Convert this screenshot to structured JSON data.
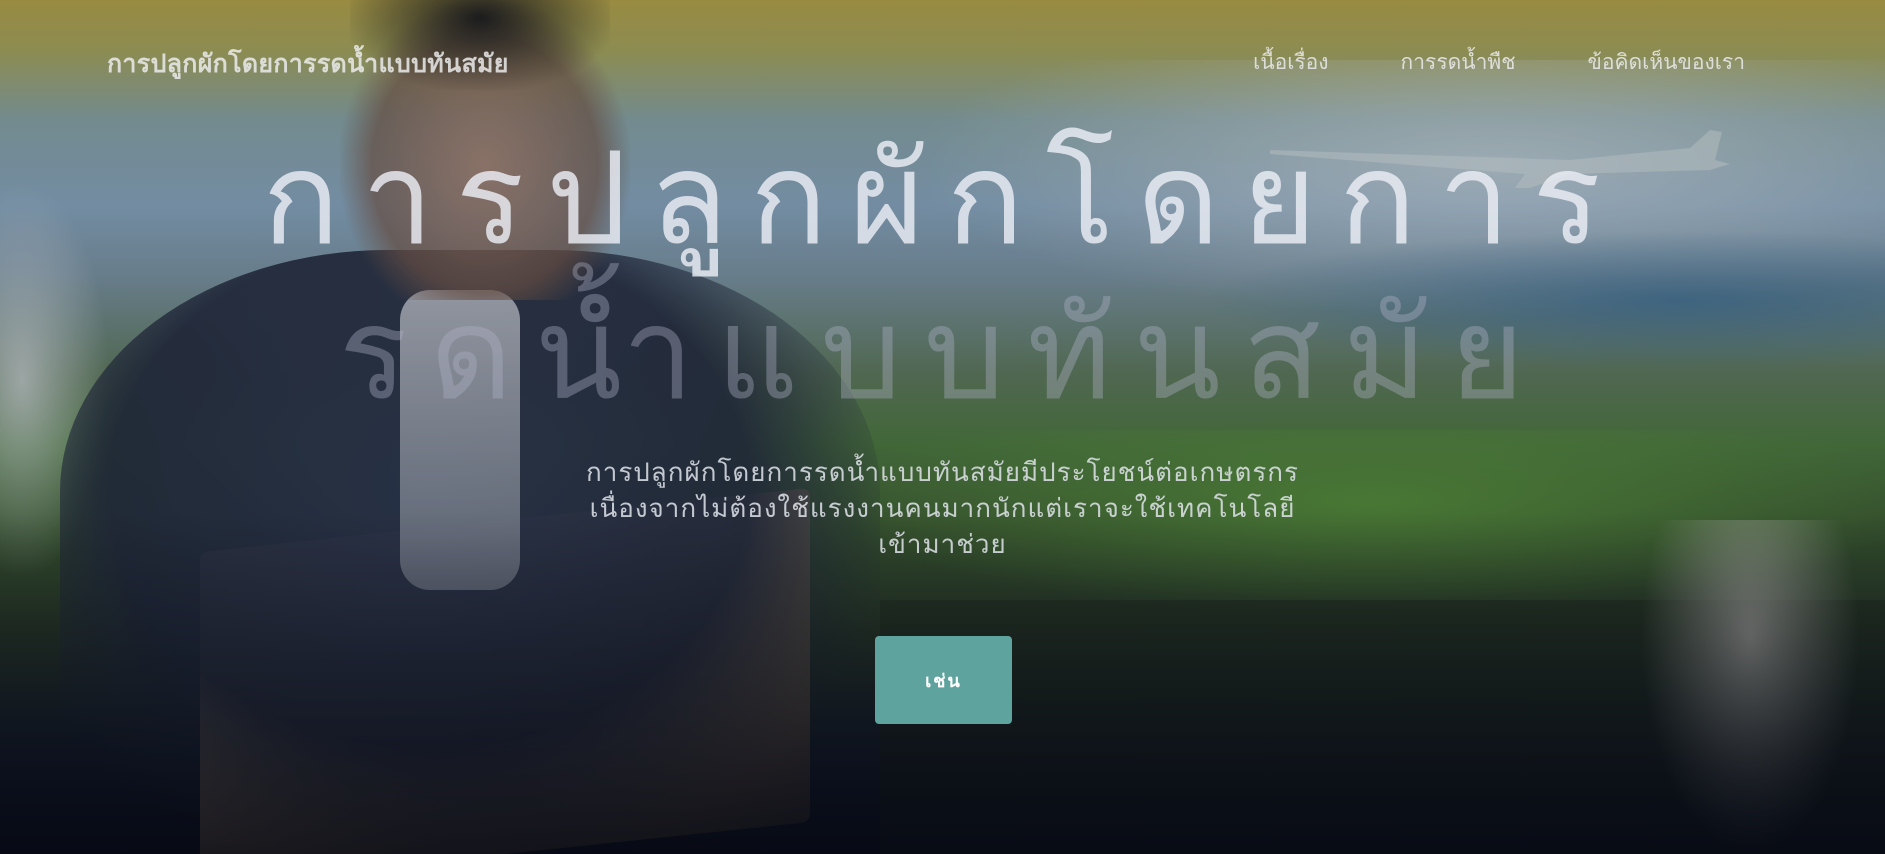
{
  "nav": {
    "brand": "การปลูกผักโดยการรดน้ำแบบทันสมัย",
    "links": [
      {
        "label": "เนื้อเรื่อง"
      },
      {
        "label": "การรดน้ำพืช"
      },
      {
        "label": "ข้อคิดเห็นของเรา"
      }
    ]
  },
  "hero": {
    "headline_line1": "การปลูกผักโดยการ",
    "headline_line2": "รดน้ำแบบทันสมัย",
    "subtitle": "การปลูกผักโดยการรดน้ำแบบทันสมัยมีประโยชน์ต่อเกษตรกร เนื่องจากไม่ต้องใช้แรงงานคนมากนักแต่เราจะใช้เทคโนโลยีเข้ามาช่วย",
    "cta_label": "เช่น"
  },
  "colors": {
    "cta_background": "#5fa39e",
    "nav_text": "#ebebeb"
  }
}
